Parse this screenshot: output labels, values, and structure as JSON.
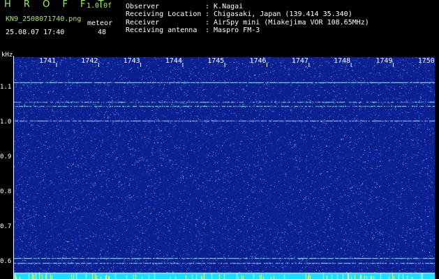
{
  "header": {
    "logo": "H R O F F T",
    "version": "1.0.0f",
    "filename": "KN9_2508071740.png",
    "datetime": "25.08.07 17:40",
    "meteor_label": "meteor",
    "meteor_count": "48"
  },
  "info": [
    {
      "label": "Observer",
      "value": ": K.Nagai"
    },
    {
      "label": "Receiving Location",
      "value": ": Chigasaki, Japan (139.414 35.340)"
    },
    {
      "label": "Receiver",
      "value": ": AirSpy mini (Miakejima VOR 108.65MHz)"
    },
    {
      "label": "Receiving antenna",
      "value": ": Maspro FM-3"
    }
  ],
  "spectrogram": {
    "y_unit": "kHz",
    "y_ticks": [
      "1.1",
      "1.0",
      "0.9",
      "0.8",
      "0.7",
      "0.6"
    ],
    "time_ticks": [
      "1741",
      "1742",
      "1743",
      "1744",
      "1745",
      "1746",
      "1747",
      "1748",
      "1749",
      "1750"
    ],
    "colors": {
      "background": "#0c1f8e",
      "noise": "#4fa8ff",
      "bottom_band": "#19e0ff",
      "meteor_spike": "#ffff40"
    }
  }
}
